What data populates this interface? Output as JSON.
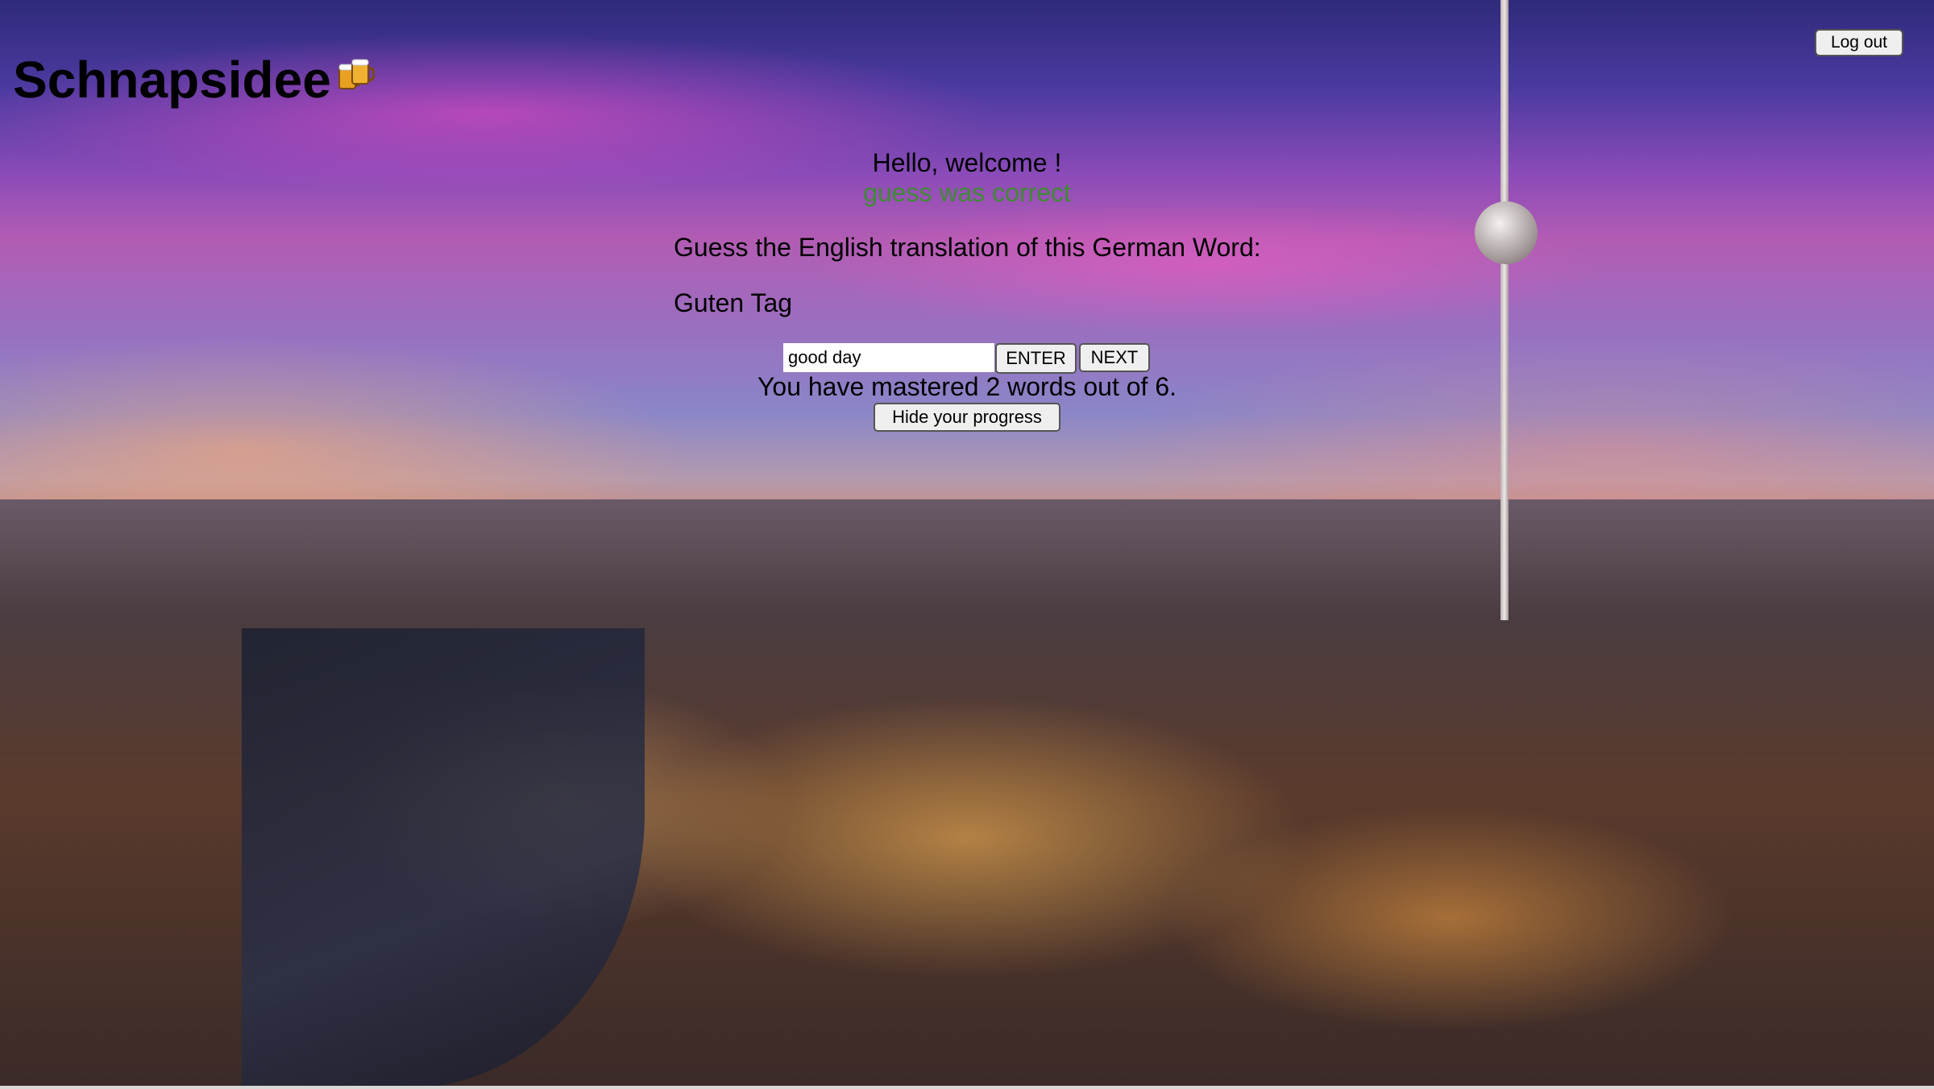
{
  "header": {
    "logo_text": "Schnapsidee",
    "logo_icon": "beer-mugs-icon",
    "logout_label": "Log out"
  },
  "main": {
    "welcome": "Hello, welcome !",
    "feedback": "guess was correct",
    "feedback_color": "#3f8a35",
    "prompt": "Guess the English translation of this German Word:",
    "german_word": "Guten Tag",
    "answer_value": "good day",
    "enter_label": "ENTER",
    "next_label": "NEXT",
    "mastered_text": "You have mastered 2 words out of 6.",
    "progress_button_label": "Hide your progress"
  }
}
